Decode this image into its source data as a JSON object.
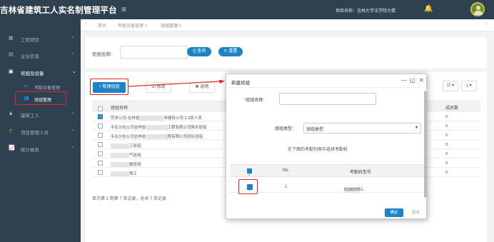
{
  "header": {
    "app_title": "吉林省建筑工人实名制管理平台",
    "menu_icon": "hamburger-icon",
    "project_label": "项目名称：吉林大学法学院大楼",
    "bell_icon": "bell-icon",
    "avatar_icon": "user-avatar"
  },
  "sidebar": {
    "items": [
      {
        "icon": "building-icon",
        "label": "工程项目"
      },
      {
        "icon": "briefcase-icon",
        "label": "企业信息"
      },
      {
        "icon": "id-card-icon",
        "label": "班组及设备"
      },
      {
        "icon": "user-icon",
        "label": "建筑工人"
      },
      {
        "icon": "graduation-cap-icon",
        "label": "项目管理人员"
      },
      {
        "icon": "line-chart-icon",
        "label": "统计报表"
      }
    ],
    "sub_items": [
      {
        "icon": "device-icon",
        "label": "考勤设备管理"
      },
      {
        "icon": "group-icon",
        "label": "班组管理"
      }
    ]
  },
  "tabs": [
    {
      "label": "首页"
    },
    {
      "label": "考勤设备管理 ×"
    },
    {
      "label": "班组管理 ×"
    }
  ],
  "search": {
    "label": "班组名称:",
    "search_button": "Q 查询",
    "reset_button": "↻ 重置"
  },
  "toolbar": {
    "new_button": "+ 新建班组",
    "edit_button": "☑ 修改",
    "delete_button": "✖ 退场",
    "columns_button": "☷ ▾",
    "export_button": "⤓ ▾"
  },
  "grid": {
    "col_name": "班组名称",
    "col_count": "成员数",
    "rows": [
      {
        "checked": true,
        "prefix": "劳务公司-吉林省",
        "suffix": "市建设公司-2.3民人员",
        "count": "0"
      },
      {
        "checked": false,
        "prefix": "专业分包公司吉林省",
        "suffix": "工程有限公司降水班组",
        "count": "0"
      },
      {
        "checked": false,
        "prefix": "专业分包公司吉林省",
        "suffix": "程有限公司班队班组",
        "count": "0"
      },
      {
        "checked": false,
        "prefix": "",
        "suffix": "工班组",
        "count": "0"
      },
      {
        "checked": false,
        "prefix": "",
        "suffix": "气班组",
        "count": "0"
      },
      {
        "checked": false,
        "prefix": "",
        "suffix": "暖班组",
        "count": "0"
      },
      {
        "checked": false,
        "prefix": "",
        "suffix": "零工",
        "count": "0"
      }
    ],
    "footer": "显示第 1 到第 7 条记录，总共 7 条记录"
  },
  "modal": {
    "title": "新建班组",
    "minimize": "—",
    "maximize": "◱",
    "close": "✕",
    "name_label": "班组名称:",
    "required_mark": "*",
    "type_label": "班组类型:",
    "type_value": "班组类型",
    "hint": "在下面的考勤列表中选择考勤机",
    "dev_col_no": "No",
    "dev_col_sn": "考勤机型号",
    "devices": [
      {
        "no": "1",
        "sn": "92860051"
      }
    ],
    "ok_button": "确定",
    "close_button": "关闭"
  },
  "colors": {
    "sidebar_bg": "#2f4050",
    "accent_blue": "#1c84c6",
    "highlight_red": "#e0262b"
  }
}
